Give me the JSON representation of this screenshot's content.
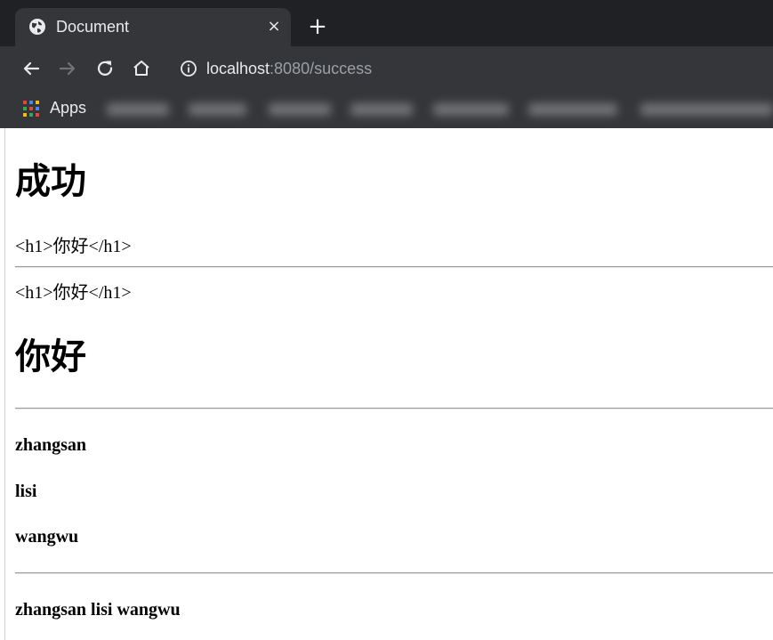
{
  "browser": {
    "tab": {
      "title": "Document",
      "close_glyph": "×"
    },
    "new_tab_glyph": "+",
    "address": {
      "host": "localhost",
      "rest": ":8080/success"
    },
    "bookmarks": {
      "apps_label": "Apps"
    }
  },
  "page": {
    "heading_success": "成功",
    "escaped_text_1": "<h1>你好</h1>",
    "escaped_text_2": "<h1>你好</h1>",
    "heading_hello": "你好",
    "names": [
      "zhangsan",
      "lisi",
      "wangwu"
    ],
    "names_inline": "zhangsan lisi wangwu"
  },
  "icons": {
    "favicon": "globe-icon",
    "back": "arrow-left-icon",
    "forward": "arrow-right-icon",
    "reload": "reload-icon",
    "home": "home-icon",
    "info": "info-icon",
    "apps": "apps-grid-icon"
  },
  "colors": {
    "chrome_dark": "#202124",
    "chrome_toolbar": "#35363a",
    "chrome_text": "#e8eaed",
    "url_dim": "#9aa0a6"
  }
}
